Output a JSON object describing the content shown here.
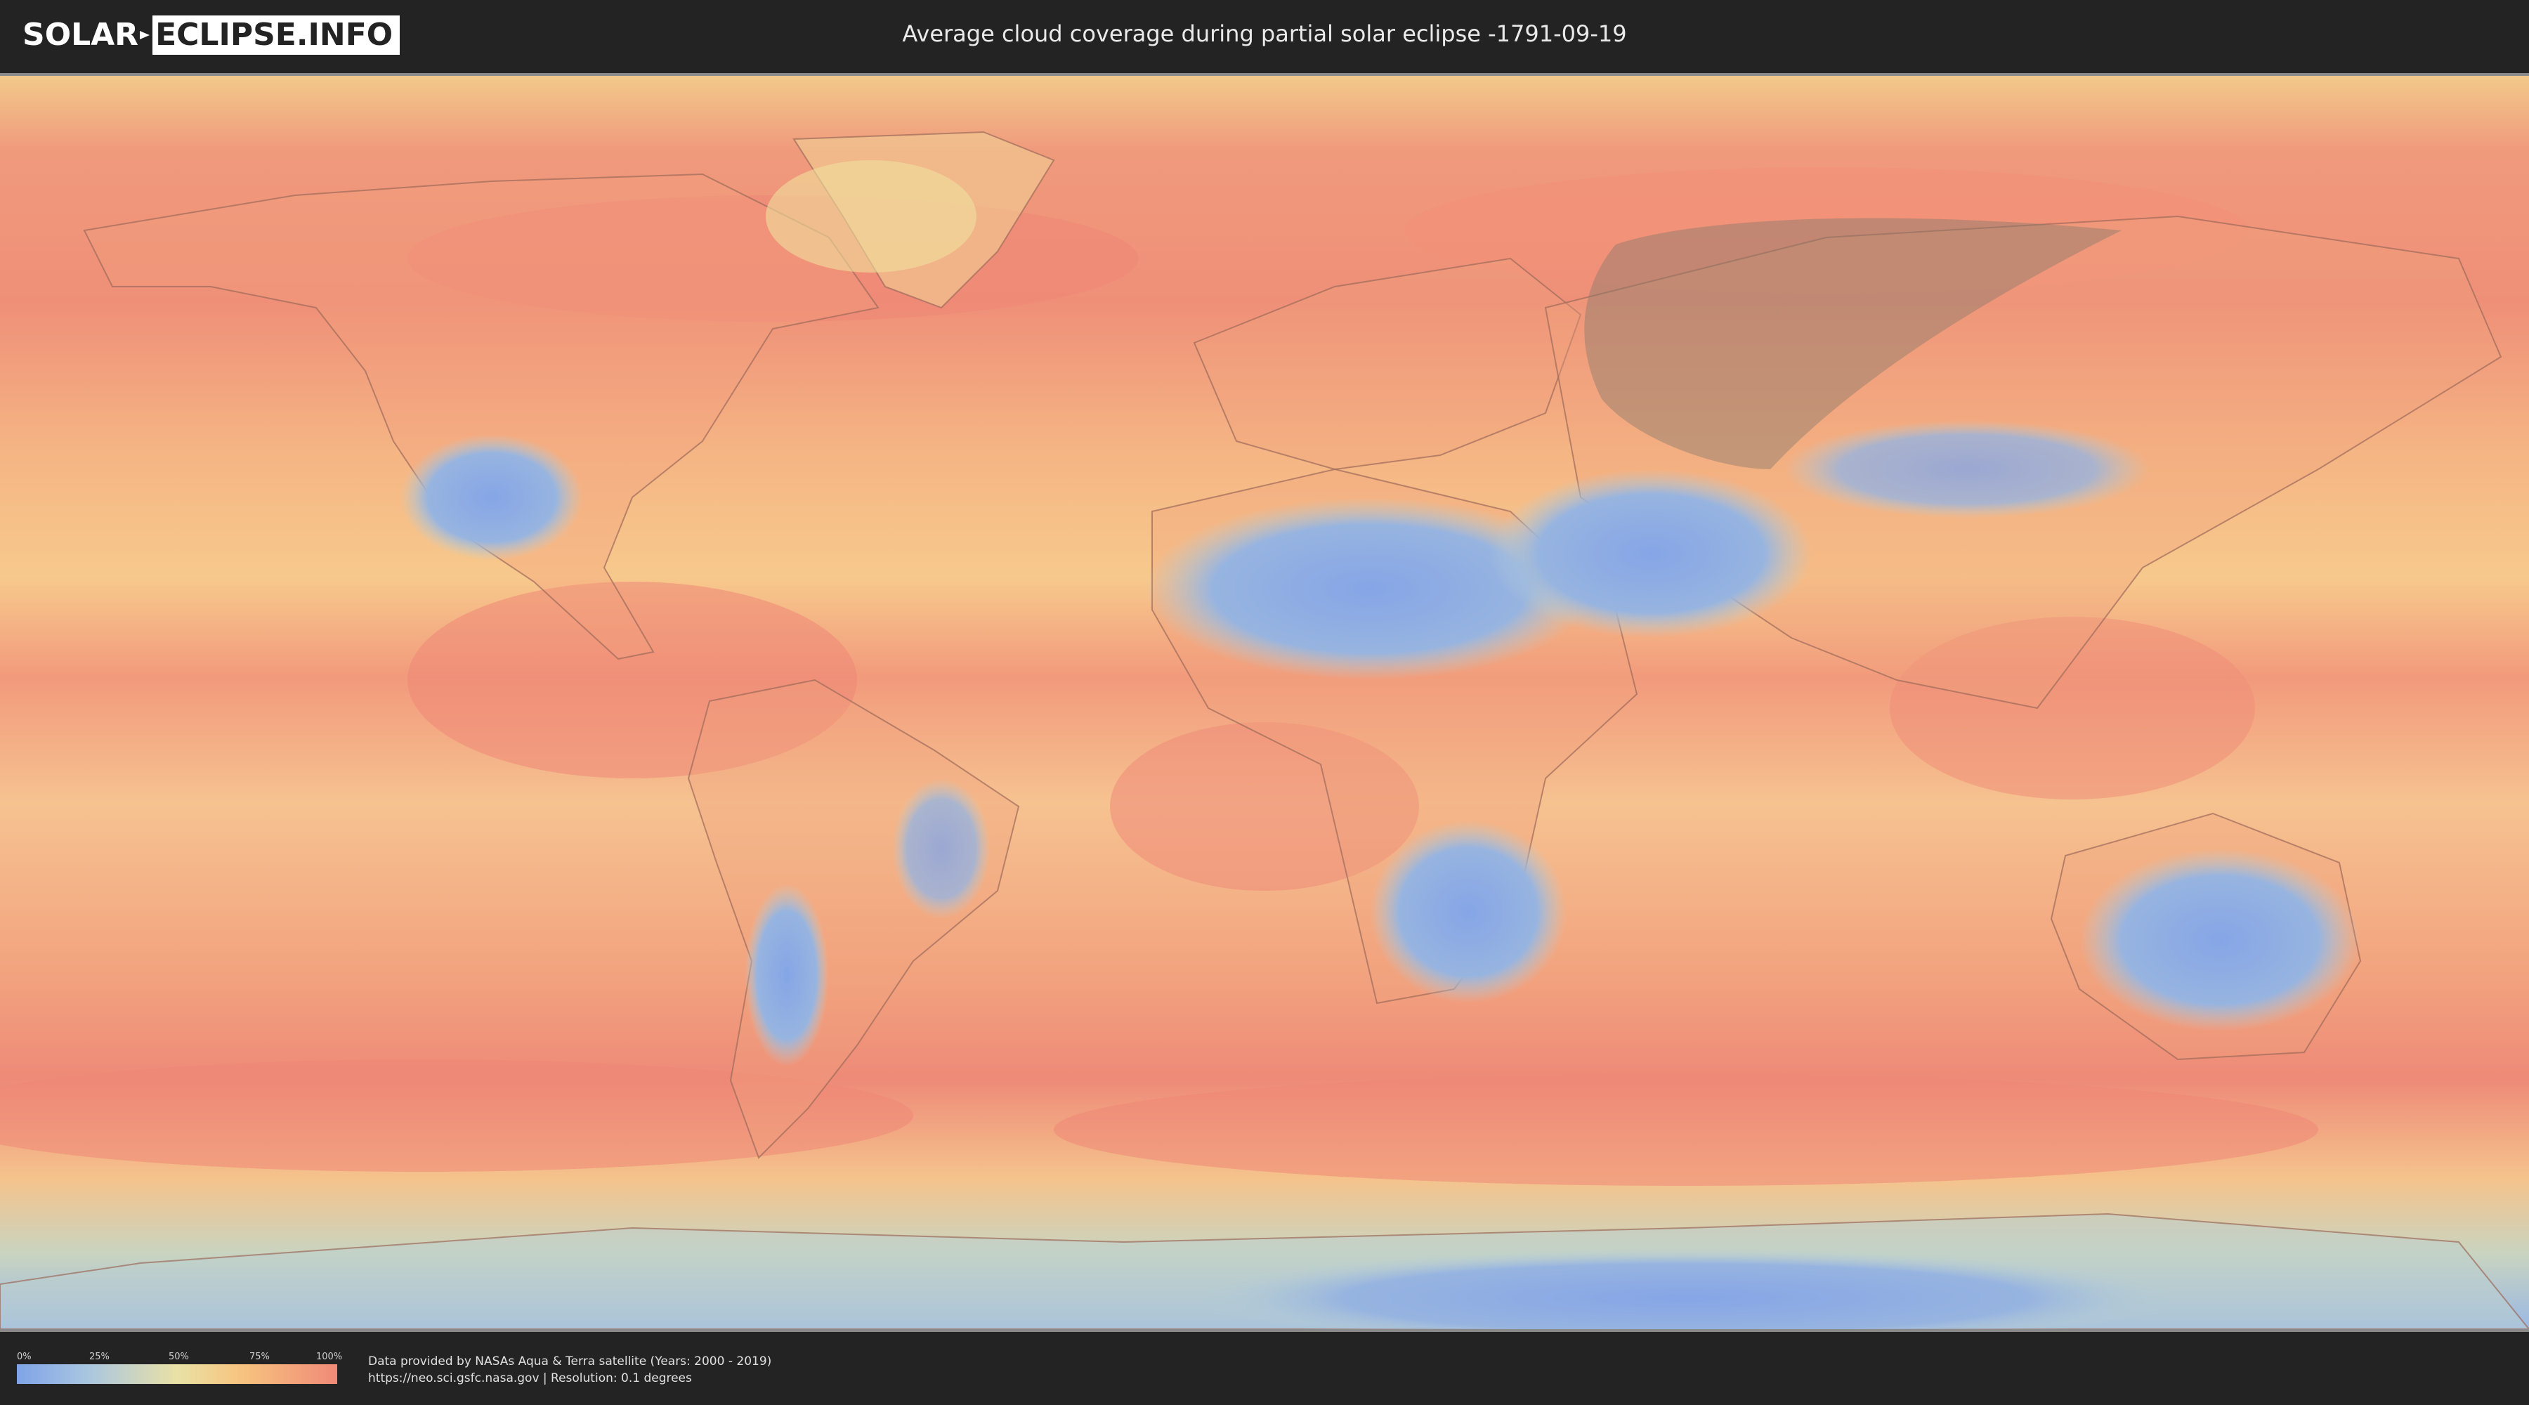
{
  "header": {
    "logo_left": "SOLAR",
    "logo_right": "ECLIPSE.INFO",
    "title": "Average cloud coverage during partial solar eclipse -1791-09-19"
  },
  "map": {
    "type": "cloud-coverage-world-map",
    "projection": "equirectangular",
    "eclipse_date": "-1791-09-19",
    "eclipse_type": "partial",
    "eclipse_zone_color": "#8a7a6a"
  },
  "legend": {
    "ticks": [
      "0%",
      "25%",
      "50%",
      "75%",
      "100%"
    ],
    "colors": [
      "#7fa3e8",
      "#a9c6e0",
      "#e9e1a6",
      "#f7c47f",
      "#f08a78"
    ]
  },
  "credits": {
    "line1": "Data provided by NASAs Aqua & Terra satellite (Years: 2000 - 2019)",
    "line2": "https://neo.sci.gsfc.nasa.gov | Resolution: 0.1 degrees"
  }
}
